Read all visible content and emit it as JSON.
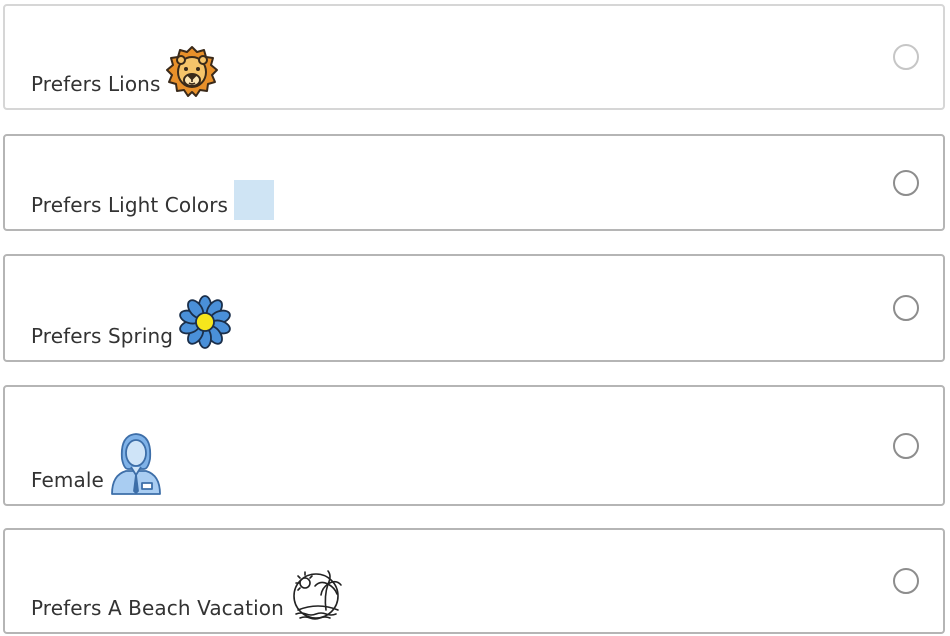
{
  "options": [
    {
      "label": "Prefers Lions",
      "icon": "lion-icon",
      "selected": false
    },
    {
      "label": "Prefers Light Colors",
      "icon": "light-color-swatch",
      "swatch_color": "#cfe4f4",
      "selected": false
    },
    {
      "label": "Prefers Spring",
      "icon": "flower-icon",
      "selected": false
    },
    {
      "label": "Female",
      "icon": "woman-avatar-icon",
      "selected": false
    },
    {
      "label": "Prefers A Beach Vacation",
      "icon": "beach-island-icon",
      "selected": false
    }
  ],
  "colors": {
    "border": "#b5b5b5",
    "radio_border": "#8d8d8d",
    "text": "#333333",
    "lion_orange": "#e8902a",
    "flower_blue": "#4a90d9",
    "flower_center": "#f6e61c",
    "avatar_blue": "#a9cdf2"
  }
}
